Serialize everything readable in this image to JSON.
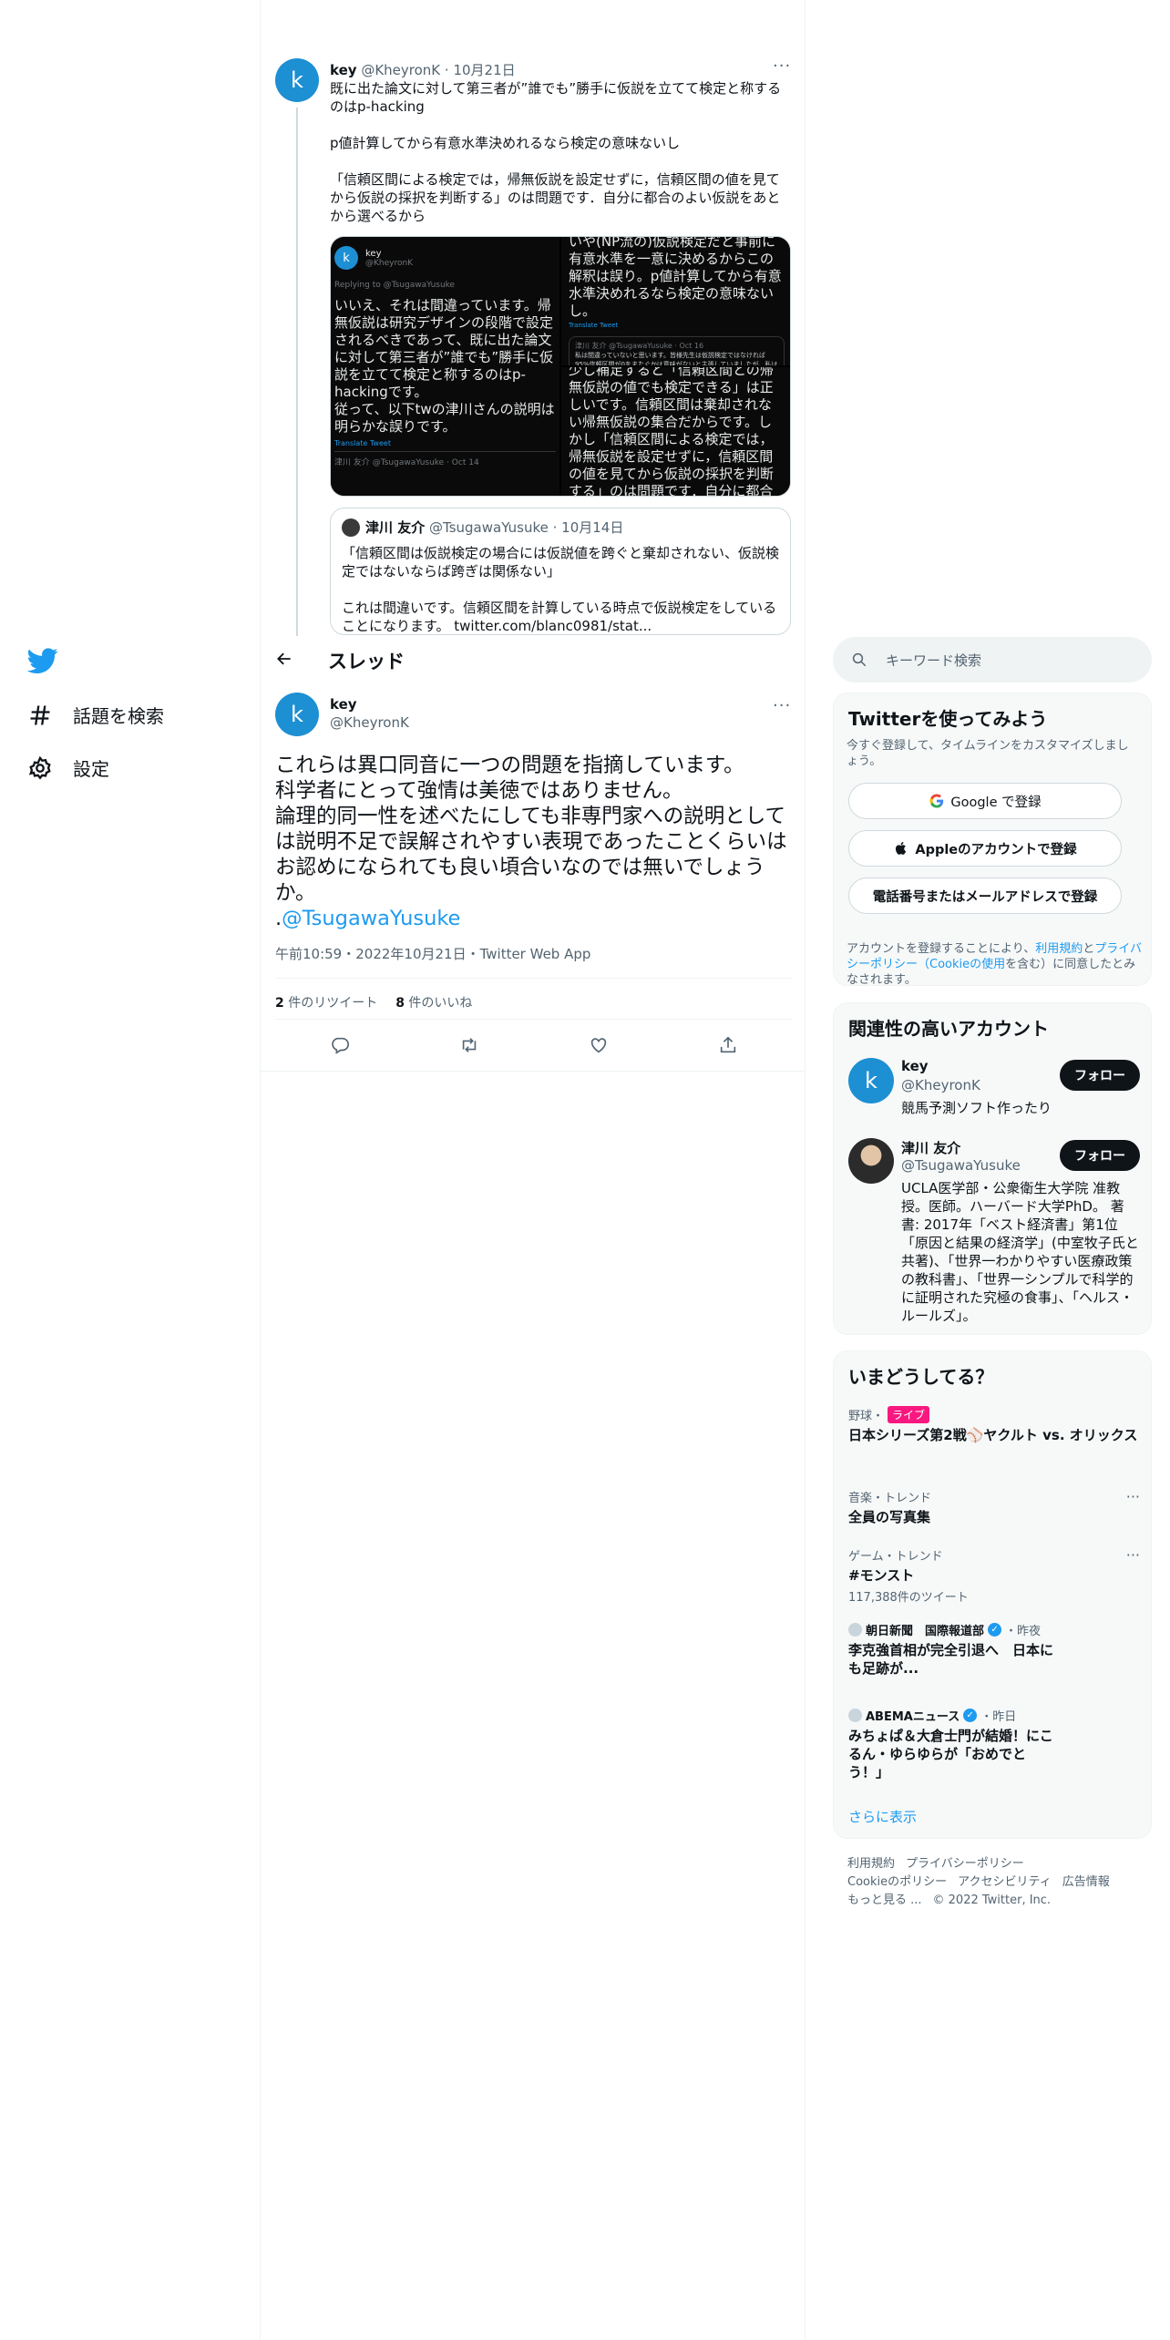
{
  "nav": {
    "explore_label": "話題を検索",
    "settings_label": "設定"
  },
  "prev_tweet": {
    "avatar_letter": "k",
    "name": "key",
    "handle": "@KheyronK",
    "date": "10月21日",
    "text": "既に出た論文に対して第三者が”誰でも”勝手に仮説を立てて検定と称するのはp-hacking\n\np値計算してから有意水準決めれるなら検定の意味ないし\n\n「信頼区間による検定では，帰無仮説を設定せずに，信頼区間の値を見てから仮説の採択を判断する」のは問題です．自分に都合のよい仮説をあとから選べるから",
    "media": {
      "p1_name": "key",
      "p1_handle": "@KheyronK",
      "p1_reply": "Replying to @TsugawaYusuke",
      "p1_text": "いいえ、それは間違っています。帰無仮説は研究デザインの段階で設定されるべきであって、既に出た論文に対して第三者が”誰でも”勝手に仮説を立てて検定と称するのはp-hackingです。\n従って、以下twの津川さんの説明は明らかな誤りです。",
      "p1_translate": "Translate Tweet",
      "p1_quote": "津川 友介 @TsugawaYusuke · Oct 14",
      "p2_text": "いや(NP流の)仮説検定だと事前に有意水準を一意に決めるからこの解釈は誤り。p値計算してから有意水準決めれるなら検定の意味ないし。",
      "p2_translate": "Translate Tweet",
      "p2_quote_head": "津川 友介 @TsugawaYusuke · Oct 16",
      "p2_quote_text": "私は間違っていないと思います。皆様先生は仮説検定ではなければ95%信頼区間が0をまたぐかは意味がないと主張していましたが、私は信頼区間を計算している",
      "p3_text": "少し補足すると「信頼区間との帰無仮説の値でも検定できる」は正しいです。信頼区間は棄却されない帰無仮説の集合だからです。しかし「信頼区間による検定では，帰無仮説を設定せずに，信頼区間の値を見てから仮説の採択を判断する」のは問題です．自分に都合のよい仮説をあとから選べるからです。"
    },
    "quote": {
      "name": "津川 友介",
      "handle": "@TsugawaYusuke",
      "date": "10月14日",
      "text": "「信頼区間は仮説検定の場合には仮説値を跨ぐと棄却されない、仮説検定ではないならば跨ぎは関係ない」\n\nこれは間違いです。信頼区間を計算している時点で仮説検定をしていることになります。 twitter.com/blanc0981/stat..."
    }
  },
  "header": {
    "title": "スレッド"
  },
  "main_tweet": {
    "avatar_letter": "k",
    "name": "key",
    "handle": "@KheyronK",
    "text": "これらは異口同音に一つの問題を指摘しています。\n科学者にとって強情は美徳ではありません。\n論理的同一性を述べたにしても非専門家への説明としては説明不足で誤解されやすい表現であったことくらいはお認めになられても良い頃合いなのでは無いでしょうか。",
    "mention_prefix": ".",
    "mention": "@TsugawaYusuke",
    "meta": "午前10:59・2022年10月21日・Twitter Web App",
    "retweet_count": "2",
    "retweet_label": "件のリツイート",
    "like_count": "8",
    "like_label": "件のいいね"
  },
  "search": {
    "placeholder": "キーワード検索"
  },
  "signup": {
    "title": "Twitterを使ってみよう",
    "subtitle": "今すぐ登録して、タイムラインをカスタマイズしましょう。",
    "google_label": "Google で登録",
    "apple_label": "Appleのアカウントで登録",
    "phone_label": "電話番号またはメールアドレスで登録",
    "foot_pre": "アカウントを登録することにより、",
    "foot_link1": "利用規約",
    "foot_mid1": "と",
    "foot_link2": "プライバシーポリシー",
    "foot_link3": "（Cookieの使用",
    "foot_post": "を含む）に同意したとみなされます。"
  },
  "related": {
    "title": "関連性の高いアカウント",
    "accounts": [
      {
        "avatar": "k",
        "name": "key",
        "handle": "@KheyronK",
        "bio": "競馬予測ソフト作ったり",
        "follow": "フォロー"
      },
      {
        "avatar": "",
        "name": "津川 友介",
        "handle": "@TsugawaYusuke",
        "bio": "UCLA医学部・公衆衛生大学院 准教授。医師。ハーバード大学PhD。 著書: 2017年「ベスト経済書」第1位「原因と結果の経済学」(中室牧子氏と共著)、「世界一わかりやすい医療政策の教科書」、「世界一シンプルで科学的に証明された究極の食事」、「ヘルス・ルールズ」。",
        "follow": "フォロー"
      }
    ]
  },
  "trends": {
    "title": "いまどうしてる？",
    "items": [
      {
        "meta": "野球・",
        "badge": "ライブ",
        "title": "日本シリーズ第2戦⚾ヤクルト vs. オリックス"
      },
      {
        "meta": "音楽・トレンド",
        "title": "全員の写真集"
      },
      {
        "meta": "ゲーム・トレンド",
        "title": "#モンスト",
        "count": "117,388件のツイート"
      },
      {
        "meta": "朝日新聞　国際報道部",
        "time": "・昨夜",
        "title": "李克強首相が完全引退へ　日本にも足跡が..."
      },
      {
        "meta": "ABEMAニュース",
        "time": "・昨日",
        "title": "みちょぱ＆大倉士門が結婚！にこるん・ゆらゆらが「おめでとう！」"
      }
    ],
    "show_more": "さらに表示"
  },
  "footer": {
    "links": [
      "利用規約",
      "プライバシーポリシー",
      "Cookieのポリシー",
      "アクセシビリティ",
      "広告情報",
      "もっと見る ...",
      "© 2022 Twitter, Inc."
    ]
  },
  "colors": {
    "brand": "#1d9bf0",
    "text": "#0f1419",
    "secondary": "#536471",
    "live": "#f91880"
  }
}
